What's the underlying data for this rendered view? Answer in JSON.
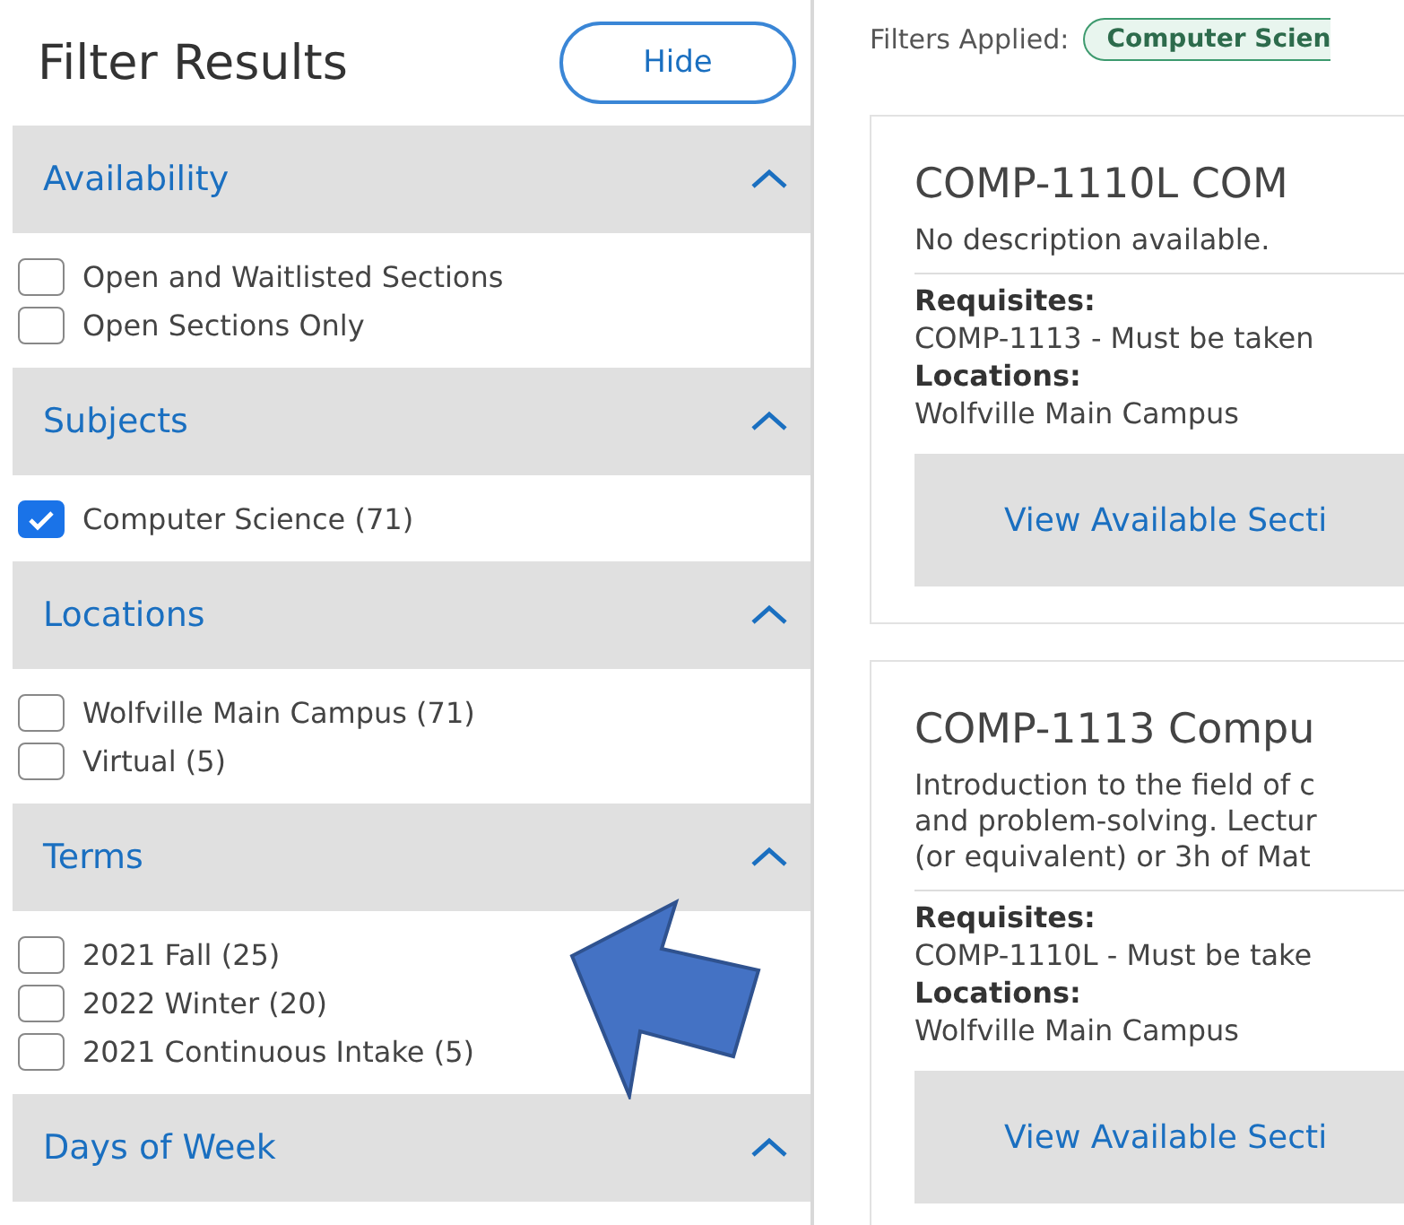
{
  "sidebar": {
    "title": "Filter Results",
    "hide_button": "Hide",
    "sections": [
      {
        "title": "Availability",
        "expanded": true,
        "options": [
          {
            "label": "Open and Waitlisted Sections",
            "checked": false
          },
          {
            "label": "Open Sections Only",
            "checked": false
          }
        ]
      },
      {
        "title": "Subjects",
        "expanded": true,
        "options": [
          {
            "label": "Computer Science (71)",
            "checked": true
          }
        ]
      },
      {
        "title": "Locations",
        "expanded": true,
        "options": [
          {
            "label": "Wolfville Main Campus (71)",
            "checked": false
          },
          {
            "label": "Virtual (5)",
            "checked": false
          }
        ]
      },
      {
        "title": "Terms",
        "expanded": true,
        "options": [
          {
            "label": "2021 Fall (25)",
            "checked": false
          },
          {
            "label": "2022 Winter (20)",
            "checked": false
          },
          {
            "label": "2021 Continuous Intake (5)",
            "checked": false
          }
        ]
      },
      {
        "title": "Days of Week",
        "expanded": true
      }
    ]
  },
  "filters_applied": {
    "label": "Filters Applied:",
    "chips": [
      "Computer Scien"
    ]
  },
  "courses": [
    {
      "title": "COMP-1110L COM",
      "description": [
        "No description available."
      ],
      "requisites_label": "Requisites:",
      "requisites": "COMP-1113 - Must be taken",
      "locations_label": "Locations:",
      "locations": "Wolfville Main Campus",
      "button": "View Available Secti"
    },
    {
      "title": "COMP-1113 Compu",
      "description": [
        "Introduction to the field of c",
        "and problem-solving. Lectur",
        "(or equivalent) or 3h of Mat"
      ],
      "requisites_label": "Requisites:",
      "requisites": "COMP-1110L - Must be take",
      "locations_label": "Locations:",
      "locations": "Wolfville Main Campus",
      "button": "View Available Secti"
    }
  ]
}
